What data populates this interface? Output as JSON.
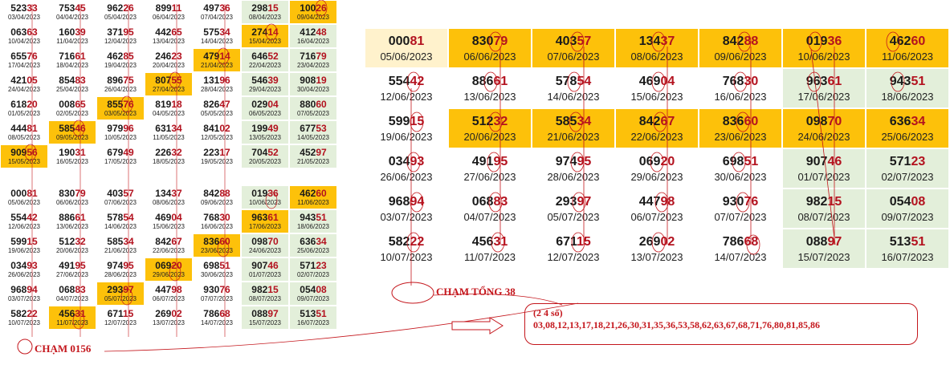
{
  "small_table_top": {
    "rows": [
      [
        {
          "n": "52333",
          "d": "03/04/2023",
          "c": "w"
        },
        {
          "n": "75345",
          "d": "04/04/2023",
          "c": "w"
        },
        {
          "n": "96226",
          "d": "05/04/2023",
          "c": "w"
        },
        {
          "n": "89911",
          "d": "06/04/2023",
          "c": "w"
        },
        {
          "n": "49736",
          "d": "07/04/2023",
          "c": "w"
        },
        {
          "n": "29815",
          "d": "08/04/2023",
          "c": "g"
        },
        {
          "n": "10026",
          "d": "09/04/2023",
          "c": "o"
        }
      ],
      [
        {
          "n": "06363",
          "d": "10/04/2023",
          "c": "w"
        },
        {
          "n": "16039",
          "d": "11/04/2023",
          "c": "w"
        },
        {
          "n": "37195",
          "d": "12/04/2023",
          "c": "w"
        },
        {
          "n": "44265",
          "d": "13/04/2023",
          "c": "w"
        },
        {
          "n": "57534",
          "d": "14/04/2023",
          "c": "w"
        },
        {
          "n": "27414",
          "d": "15/04/2023",
          "c": "o"
        },
        {
          "n": "41248",
          "d": "16/04/2023",
          "c": "g"
        }
      ],
      [
        {
          "n": "65576",
          "d": "17/04/2023",
          "c": "w"
        },
        {
          "n": "71661",
          "d": "18/04/2023",
          "c": "w"
        },
        {
          "n": "46285",
          "d": "19/04/2023",
          "c": "w"
        },
        {
          "n": "24623",
          "d": "20/04/2023",
          "c": "w"
        },
        {
          "n": "47914",
          "d": "21/04/2023",
          "c": "o"
        },
        {
          "n": "64652",
          "d": "22/04/2023",
          "c": "g"
        },
        {
          "n": "71679",
          "d": "23/04/2023",
          "c": "g"
        }
      ],
      [
        {
          "n": "42105",
          "d": "24/04/2023",
          "c": "w"
        },
        {
          "n": "85483",
          "d": "25/04/2023",
          "c": "w"
        },
        {
          "n": "89675",
          "d": "26/04/2023",
          "c": "w"
        },
        {
          "n": "80755",
          "d": "27/04/2023",
          "c": "o"
        },
        {
          "n": "13196",
          "d": "28/04/2023",
          "c": "w"
        },
        {
          "n": "54639",
          "d": "29/04/2023",
          "c": "g"
        },
        {
          "n": "90819",
          "d": "30/04/2023",
          "c": "g"
        }
      ],
      [
        {
          "n": "61820",
          "d": "01/05/2023",
          "c": "w"
        },
        {
          "n": "00865",
          "d": "02/05/2023",
          "c": "w"
        },
        {
          "n": "85576",
          "d": "03/05/2023",
          "c": "o"
        },
        {
          "n": "81918",
          "d": "04/05/2023",
          "c": "w"
        },
        {
          "n": "82647",
          "d": "05/05/2023",
          "c": "w"
        },
        {
          "n": "02904",
          "d": "06/05/2023",
          "c": "g"
        },
        {
          "n": "88060",
          "d": "07/05/2023",
          "c": "g"
        }
      ],
      [
        {
          "n": "44481",
          "d": "08/05/2023",
          "c": "w"
        },
        {
          "n": "58546",
          "d": "09/05/2023",
          "c": "o"
        },
        {
          "n": "97996",
          "d": "10/05/2023",
          "c": "w"
        },
        {
          "n": "63134",
          "d": "11/05/2023",
          "c": "w"
        },
        {
          "n": "84102",
          "d": "12/05/2023",
          "c": "w"
        },
        {
          "n": "19949",
          "d": "13/05/2023",
          "c": "g"
        },
        {
          "n": "67753",
          "d": "14/05/2023",
          "c": "g"
        }
      ],
      [
        {
          "n": "90956",
          "d": "15/05/2023",
          "c": "o"
        },
        {
          "n": "19031",
          "d": "16/05/2023",
          "c": "w"
        },
        {
          "n": "67949",
          "d": "17/05/2023",
          "c": "w"
        },
        {
          "n": "22632",
          "d": "18/05/2023",
          "c": "w"
        },
        {
          "n": "22317",
          "d": "19/05/2023",
          "c": "w"
        },
        {
          "n": "70452",
          "d": "20/05/2023",
          "c": "g"
        },
        {
          "n": "45297",
          "d": "21/05/2023",
          "c": "g"
        }
      ]
    ]
  },
  "small_table_bottom": {
    "rows": [
      [
        {
          "n": "00081",
          "d": "05/06/2023",
          "c": "w"
        },
        {
          "n": "83079",
          "d": "06/06/2023",
          "c": "w"
        },
        {
          "n": "40357",
          "d": "07/06/2023",
          "c": "w"
        },
        {
          "n": "13437",
          "d": "08/06/2023",
          "c": "w"
        },
        {
          "n": "84288",
          "d": "09/06/2023",
          "c": "w"
        },
        {
          "n": "01936",
          "d": "10/06/2023",
          "c": "g"
        },
        {
          "n": "46260",
          "d": "11/06/2023",
          "c": "o"
        }
      ],
      [
        {
          "n": "55442",
          "d": "12/06/2023",
          "c": "w"
        },
        {
          "n": "88661",
          "d": "13/06/2023",
          "c": "w"
        },
        {
          "n": "57854",
          "d": "14/06/2023",
          "c": "w"
        },
        {
          "n": "46904",
          "d": "15/06/2023",
          "c": "w"
        },
        {
          "n": "76830",
          "d": "16/06/2023",
          "c": "w"
        },
        {
          "n": "96361",
          "d": "17/06/2023",
          "c": "o"
        },
        {
          "n": "94351",
          "d": "18/06/2023",
          "c": "g"
        }
      ],
      [
        {
          "n": "59915",
          "d": "19/06/2023",
          "c": "w"
        },
        {
          "n": "51232",
          "d": "20/06/2023",
          "c": "w"
        },
        {
          "n": "58534",
          "d": "21/06/2023",
          "c": "w"
        },
        {
          "n": "84267",
          "d": "22/06/2023",
          "c": "w"
        },
        {
          "n": "83660",
          "d": "23/06/2023",
          "c": "o"
        },
        {
          "n": "09870",
          "d": "24/06/2023",
          "c": "g"
        },
        {
          "n": "63634",
          "d": "25/06/2023",
          "c": "g"
        }
      ],
      [
        {
          "n": "03493",
          "d": "26/06/2023",
          "c": "w"
        },
        {
          "n": "49195",
          "d": "27/06/2023",
          "c": "w"
        },
        {
          "n": "97495",
          "d": "28/06/2023",
          "c": "w"
        },
        {
          "n": "06920",
          "d": "29/06/2023",
          "c": "o"
        },
        {
          "n": "69851",
          "d": "30/06/2023",
          "c": "w"
        },
        {
          "n": "90746",
          "d": "01/07/2023",
          "c": "g"
        },
        {
          "n": "57123",
          "d": "02/07/2023",
          "c": "g"
        }
      ],
      [
        {
          "n": "96894",
          "d": "03/07/2023",
          "c": "w"
        },
        {
          "n": "06883",
          "d": "04/07/2023",
          "c": "w"
        },
        {
          "n": "29397",
          "d": "05/07/2023",
          "c": "o"
        },
        {
          "n": "44798",
          "d": "06/07/2023",
          "c": "w"
        },
        {
          "n": "93076",
          "d": "07/07/2023",
          "c": "w"
        },
        {
          "n": "98215",
          "d": "08/07/2023",
          "c": "g"
        },
        {
          "n": "05408",
          "d": "09/07/2023",
          "c": "g"
        }
      ],
      [
        {
          "n": "58222",
          "d": "10/07/2023",
          "c": "w"
        },
        {
          "n": "45631",
          "d": "11/07/2023",
          "c": "o"
        },
        {
          "n": "67115",
          "d": "12/07/2023",
          "c": "w"
        },
        {
          "n": "26902",
          "d": "13/07/2023",
          "c": "w"
        },
        {
          "n": "78668",
          "d": "14/07/2023",
          "c": "w"
        },
        {
          "n": "08897",
          "d": "15/07/2023",
          "c": "g"
        },
        {
          "n": "51351",
          "d": "16/07/2023",
          "c": "g"
        }
      ]
    ]
  },
  "big_table": {
    "rows": [
      [
        {
          "n": "00081",
          "d": "05/06/2023",
          "c": "y"
        },
        {
          "n": "83079",
          "d": "06/06/2023",
          "c": "o"
        },
        {
          "n": "40357",
          "d": "07/06/2023",
          "c": "o"
        },
        {
          "n": "13437",
          "d": "08/06/2023",
          "c": "o"
        },
        {
          "n": "84288",
          "d": "09/06/2023",
          "c": "o"
        },
        {
          "n": "01936",
          "d": "10/06/2023",
          "c": "o"
        },
        {
          "n": "46260",
          "d": "11/06/2023",
          "c": "o"
        }
      ],
      [
        {
          "n": "55442",
          "d": "12/06/2023",
          "c": "w"
        },
        {
          "n": "88661",
          "d": "13/06/2023",
          "c": "w"
        },
        {
          "n": "57854",
          "d": "14/06/2023",
          "c": "w"
        },
        {
          "n": "46904",
          "d": "15/06/2023",
          "c": "w"
        },
        {
          "n": "76830",
          "d": "16/06/2023",
          "c": "w"
        },
        {
          "n": "96361",
          "d": "17/06/2023",
          "c": "g"
        },
        {
          "n": "94351",
          "d": "18/06/2023",
          "c": "g"
        }
      ],
      [
        {
          "n": "59915",
          "d": "19/06/2023",
          "c": "w"
        },
        {
          "n": "51232",
          "d": "20/06/2023",
          "c": "o"
        },
        {
          "n": "58534",
          "d": "21/06/2023",
          "c": "o"
        },
        {
          "n": "84267",
          "d": "22/06/2023",
          "c": "o"
        },
        {
          "n": "83660",
          "d": "23/06/2023",
          "c": "o"
        },
        {
          "n": "09870",
          "d": "24/06/2023",
          "c": "o"
        },
        {
          "n": "63634",
          "d": "25/06/2023",
          "c": "o"
        }
      ],
      [
        {
          "n": "03493",
          "d": "26/06/2023",
          "c": "w"
        },
        {
          "n": "49195",
          "d": "27/06/2023",
          "c": "w"
        },
        {
          "n": "97495",
          "d": "28/06/2023",
          "c": "w"
        },
        {
          "n": "06920",
          "d": "29/06/2023",
          "c": "w"
        },
        {
          "n": "69851",
          "d": "30/06/2023",
          "c": "w"
        },
        {
          "n": "90746",
          "d": "01/07/2023",
          "c": "g"
        },
        {
          "n": "57123",
          "d": "02/07/2023",
          "c": "g"
        }
      ],
      [
        {
          "n": "96894",
          "d": "03/07/2023",
          "c": "w"
        },
        {
          "n": "06883",
          "d": "04/07/2023",
          "c": "w"
        },
        {
          "n": "29397",
          "d": "05/07/2023",
          "c": "w"
        },
        {
          "n": "44798",
          "d": "06/07/2023",
          "c": "w"
        },
        {
          "n": "93076",
          "d": "07/07/2023",
          "c": "w"
        },
        {
          "n": "98215",
          "d": "08/07/2023",
          "c": "g"
        },
        {
          "n": "05408",
          "d": "09/07/2023",
          "c": "g"
        }
      ],
      [
        {
          "n": "58222",
          "d": "10/07/2023",
          "c": "w"
        },
        {
          "n": "45631",
          "d": "11/07/2023",
          "c": "w"
        },
        {
          "n": "67115",
          "d": "12/07/2023",
          "c": "w"
        },
        {
          "n": "26902",
          "d": "13/07/2023",
          "c": "w"
        },
        {
          "n": "78668",
          "d": "14/07/2023",
          "c": "w"
        },
        {
          "n": "08897",
          "d": "15/07/2023",
          "c": "g"
        },
        {
          "n": "51351",
          "d": "16/07/2023",
          "c": "g"
        }
      ]
    ]
  },
  "annotations": {
    "cham_tong": "CHẠM TỔNG 38",
    "cham_0156": "CHẠM 0156",
    "result_heading": "(2 4 số)",
    "result_numbers": "03,08,12,13,17,18,21,26,30,31,35,36,53,58,62,63,67,68,71,76,80,81,85,86"
  },
  "colors": {
    "orange": "#fdc10a",
    "green": "#e3efda",
    "pale_yellow": "#fff2cc",
    "red": "#c4161c"
  }
}
